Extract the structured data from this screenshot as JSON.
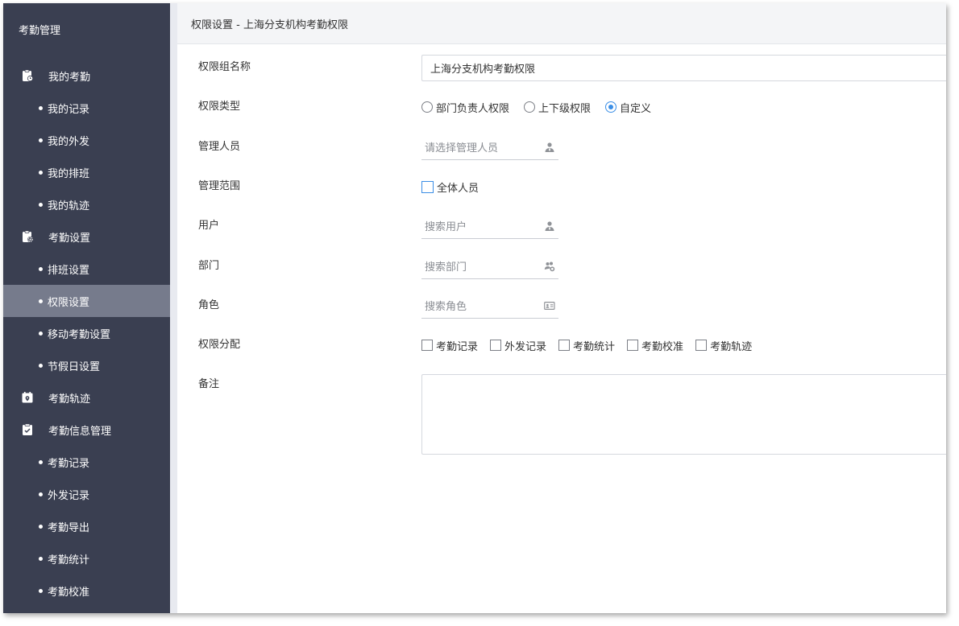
{
  "sidebar": {
    "title": "考勤管理",
    "items": [
      {
        "type": "group",
        "label": "我的考勤",
        "icon": "clipboard-clock-icon"
      },
      {
        "type": "sub",
        "label": "我的记录"
      },
      {
        "type": "sub",
        "label": "我的外发"
      },
      {
        "type": "sub",
        "label": "我的排班"
      },
      {
        "type": "sub",
        "label": "我的轨迹"
      },
      {
        "type": "group",
        "label": "考勤设置",
        "icon": "clipboard-gear-icon"
      },
      {
        "type": "sub",
        "label": "排班设置"
      },
      {
        "type": "sub",
        "label": "权限设置",
        "active": true
      },
      {
        "type": "sub",
        "label": "移动考勤设置"
      },
      {
        "type": "sub",
        "label": "节假日设置"
      },
      {
        "type": "group",
        "label": "考勤轨迹",
        "icon": "calendar-location-icon"
      },
      {
        "type": "group",
        "label": "考勤信息管理",
        "icon": "clipboard-check-icon"
      },
      {
        "type": "sub",
        "label": "考勤记录"
      },
      {
        "type": "sub",
        "label": "外发记录"
      },
      {
        "type": "sub",
        "label": "考勤导出"
      },
      {
        "type": "sub",
        "label": "考勤统计"
      },
      {
        "type": "sub",
        "label": "考勤校准"
      }
    ]
  },
  "header": {
    "title": "权限设置 - 上海分支机构考勤权限"
  },
  "form": {
    "group_name": {
      "label": "权限组名称",
      "value": "上海分支机构考勤权限"
    },
    "perm_type": {
      "label": "权限类型",
      "options": [
        {
          "label": "部门负责人权限",
          "checked": false
        },
        {
          "label": "上下级权限",
          "checked": false
        },
        {
          "label": "自定义",
          "checked": true
        }
      ]
    },
    "managers": {
      "label": "管理人员",
      "placeholder": "请选择管理人员",
      "icon": "user-icon"
    },
    "scope": {
      "label": "管理范围",
      "checkbox_label": "全体人员",
      "checked": false
    },
    "users": {
      "label": "用户",
      "placeholder": "搜索用户",
      "icon": "user-icon"
    },
    "departments": {
      "label": "部门",
      "placeholder": "搜索部门",
      "icon": "group-icon"
    },
    "roles": {
      "label": "角色",
      "placeholder": "搜索角色",
      "icon": "id-card-icon"
    },
    "allocation": {
      "label": "权限分配",
      "options": [
        {
          "label": "考勤记录",
          "checked": false
        },
        {
          "label": "外发记录",
          "checked": false
        },
        {
          "label": "考勤统计",
          "checked": false
        },
        {
          "label": "考勤校准",
          "checked": false
        },
        {
          "label": "考勤轨迹",
          "checked": false
        }
      ]
    },
    "remark": {
      "label": "备注",
      "value": ""
    }
  },
  "colors": {
    "sidebar_bg": "#3a3f51",
    "sidebar_active": "#767b8c",
    "accent": "#3a8ee6"
  }
}
